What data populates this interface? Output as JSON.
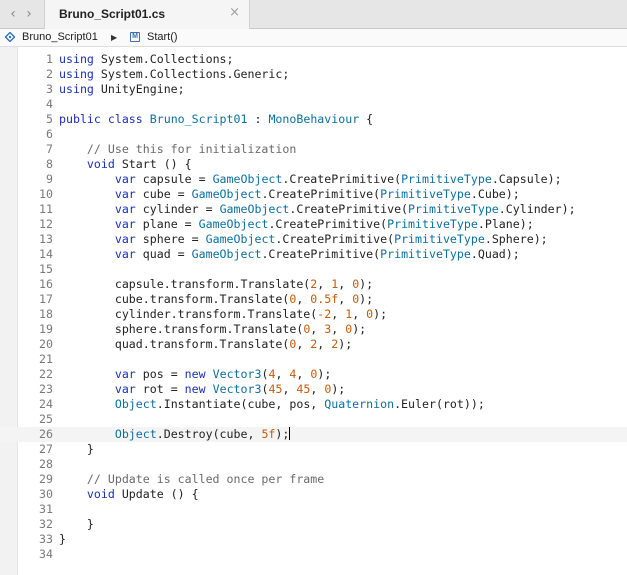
{
  "tab": {
    "title": "Bruno_Script01.cs",
    "close_glyph": "×"
  },
  "nav": {
    "back_glyph": "‹",
    "forward_glyph": "›"
  },
  "pathbar": {
    "file": "Bruno_Script01",
    "separator": "▶",
    "method": "Start()",
    "method_icon_letter": "M"
  },
  "colors": {
    "keyword": "#1a2fb8",
    "type": "#0b6fa0",
    "comment": "#6a6a6a",
    "number": "#c75a07"
  },
  "current_line": 26,
  "lines": [
    {
      "n": "1",
      "t": [
        [
          "k",
          "using"
        ],
        [
          "p",
          " System.Collections;"
        ]
      ]
    },
    {
      "n": "2",
      "t": [
        [
          "k",
          "using"
        ],
        [
          "p",
          " System.Collections.Generic;"
        ]
      ]
    },
    {
      "n": "3",
      "t": [
        [
          "k",
          "using"
        ],
        [
          "p",
          " UnityEngine;"
        ]
      ]
    },
    {
      "n": "4",
      "t": []
    },
    {
      "n": "5",
      "t": [
        [
          "k",
          "public class"
        ],
        [
          "p",
          " "
        ],
        [
          "t",
          "Bruno_Script01"
        ],
        [
          "p",
          " : "
        ],
        [
          "t",
          "MonoBehaviour"
        ],
        [
          "p",
          " {"
        ]
      ]
    },
    {
      "n": "6",
      "t": []
    },
    {
      "n": "7",
      "t": [
        [
          "p",
          "    "
        ],
        [
          "c",
          "// Use this for initialization"
        ]
      ]
    },
    {
      "n": "8",
      "t": [
        [
          "p",
          "    "
        ],
        [
          "k",
          "void"
        ],
        [
          "p",
          " Start () {"
        ]
      ]
    },
    {
      "n": "9",
      "t": [
        [
          "p",
          "        "
        ],
        [
          "k",
          "var"
        ],
        [
          "p",
          " capsule = "
        ],
        [
          "t",
          "GameObject"
        ],
        [
          "p",
          ".CreatePrimitive("
        ],
        [
          "t",
          "PrimitiveType"
        ],
        [
          "p",
          ".Capsule);"
        ]
      ]
    },
    {
      "n": "10",
      "t": [
        [
          "p",
          "        "
        ],
        [
          "k",
          "var"
        ],
        [
          "p",
          " cube = "
        ],
        [
          "t",
          "GameObject"
        ],
        [
          "p",
          ".CreatePrimitive("
        ],
        [
          "t",
          "PrimitiveType"
        ],
        [
          "p",
          ".Cube);"
        ]
      ]
    },
    {
      "n": "11",
      "t": [
        [
          "p",
          "        "
        ],
        [
          "k",
          "var"
        ],
        [
          "p",
          " cylinder = "
        ],
        [
          "t",
          "GameObject"
        ],
        [
          "p",
          ".CreatePrimitive("
        ],
        [
          "t",
          "PrimitiveType"
        ],
        [
          "p",
          ".Cylinder);"
        ]
      ]
    },
    {
      "n": "12",
      "t": [
        [
          "p",
          "        "
        ],
        [
          "k",
          "var"
        ],
        [
          "p",
          " plane = "
        ],
        [
          "t",
          "GameObject"
        ],
        [
          "p",
          ".CreatePrimitive("
        ],
        [
          "t",
          "PrimitiveType"
        ],
        [
          "p",
          ".Plane);"
        ]
      ]
    },
    {
      "n": "13",
      "t": [
        [
          "p",
          "        "
        ],
        [
          "k",
          "var"
        ],
        [
          "p",
          " sphere = "
        ],
        [
          "t",
          "GameObject"
        ],
        [
          "p",
          ".CreatePrimitive("
        ],
        [
          "t",
          "PrimitiveType"
        ],
        [
          "p",
          ".Sphere);"
        ]
      ]
    },
    {
      "n": "14",
      "t": [
        [
          "p",
          "        "
        ],
        [
          "k",
          "var"
        ],
        [
          "p",
          " quad = "
        ],
        [
          "t",
          "GameObject"
        ],
        [
          "p",
          ".CreatePrimitive("
        ],
        [
          "t",
          "PrimitiveType"
        ],
        [
          "p",
          ".Quad);"
        ]
      ]
    },
    {
      "n": "15",
      "t": []
    },
    {
      "n": "16",
      "t": [
        [
          "p",
          "        capsule.transform.Translate("
        ],
        [
          "n",
          "2"
        ],
        [
          "p",
          ", "
        ],
        [
          "n",
          "1"
        ],
        [
          "p",
          ", "
        ],
        [
          "n",
          "0"
        ],
        [
          "p",
          ");"
        ]
      ]
    },
    {
      "n": "17",
      "t": [
        [
          "p",
          "        cube.transform.Translate("
        ],
        [
          "n",
          "0"
        ],
        [
          "p",
          ", "
        ],
        [
          "n",
          "0.5f"
        ],
        [
          "p",
          ", "
        ],
        [
          "n",
          "0"
        ],
        [
          "p",
          ");"
        ]
      ]
    },
    {
      "n": "18",
      "t": [
        [
          "p",
          "        cylinder.transform.Translate("
        ],
        [
          "n",
          "-2"
        ],
        [
          "p",
          ", "
        ],
        [
          "n",
          "1"
        ],
        [
          "p",
          ", "
        ],
        [
          "n",
          "0"
        ],
        [
          "p",
          ");"
        ]
      ]
    },
    {
      "n": "19",
      "t": [
        [
          "p",
          "        sphere.transform.Translate("
        ],
        [
          "n",
          "0"
        ],
        [
          "p",
          ", "
        ],
        [
          "n",
          "3"
        ],
        [
          "p",
          ", "
        ],
        [
          "n",
          "0"
        ],
        [
          "p",
          ");"
        ]
      ]
    },
    {
      "n": "20",
      "t": [
        [
          "p",
          "        quad.transform.Translate("
        ],
        [
          "n",
          "0"
        ],
        [
          "p",
          ", "
        ],
        [
          "n",
          "2"
        ],
        [
          "p",
          ", "
        ],
        [
          "n",
          "2"
        ],
        [
          "p",
          ");"
        ]
      ]
    },
    {
      "n": "21",
      "t": []
    },
    {
      "n": "22",
      "t": [
        [
          "p",
          "        "
        ],
        [
          "k",
          "var"
        ],
        [
          "p",
          " pos = "
        ],
        [
          "k",
          "new"
        ],
        [
          "p",
          " "
        ],
        [
          "t",
          "Vector3"
        ],
        [
          "p",
          "("
        ],
        [
          "n",
          "4"
        ],
        [
          "p",
          ", "
        ],
        [
          "n",
          "4"
        ],
        [
          "p",
          ", "
        ],
        [
          "n",
          "0"
        ],
        [
          "p",
          ");"
        ]
      ]
    },
    {
      "n": "23",
      "t": [
        [
          "p",
          "        "
        ],
        [
          "k",
          "var"
        ],
        [
          "p",
          " rot = "
        ],
        [
          "k",
          "new"
        ],
        [
          "p",
          " "
        ],
        [
          "t",
          "Vector3"
        ],
        [
          "p",
          "("
        ],
        [
          "n",
          "45"
        ],
        [
          "p",
          ", "
        ],
        [
          "n",
          "45"
        ],
        [
          "p",
          ", "
        ],
        [
          "n",
          "0"
        ],
        [
          "p",
          ");"
        ]
      ]
    },
    {
      "n": "24",
      "t": [
        [
          "p",
          "        "
        ],
        [
          "t",
          "Object"
        ],
        [
          "p",
          ".Instantiate(cube, pos, "
        ],
        [
          "t",
          "Quaternion"
        ],
        [
          "p",
          ".Euler(rot));"
        ]
      ]
    },
    {
      "n": "25",
      "t": []
    },
    {
      "n": "26",
      "t": [
        [
          "p",
          "        "
        ],
        [
          "t",
          "Object"
        ],
        [
          "p",
          ".Destroy(cube, "
        ],
        [
          "n",
          "5f"
        ],
        [
          "p",
          ");"
        ]
      ]
    },
    {
      "n": "27",
      "t": [
        [
          "p",
          "    }"
        ]
      ]
    },
    {
      "n": "28",
      "t": []
    },
    {
      "n": "29",
      "t": [
        [
          "p",
          "    "
        ],
        [
          "c",
          "// Update is called once per frame"
        ]
      ]
    },
    {
      "n": "30",
      "t": [
        [
          "p",
          "    "
        ],
        [
          "k",
          "void"
        ],
        [
          "p",
          " Update () {"
        ]
      ]
    },
    {
      "n": "31",
      "t": []
    },
    {
      "n": "32",
      "t": [
        [
          "p",
          "    }"
        ]
      ]
    },
    {
      "n": "33",
      "t": [
        [
          "p",
          "}"
        ]
      ]
    },
    {
      "n": "34",
      "t": []
    }
  ]
}
